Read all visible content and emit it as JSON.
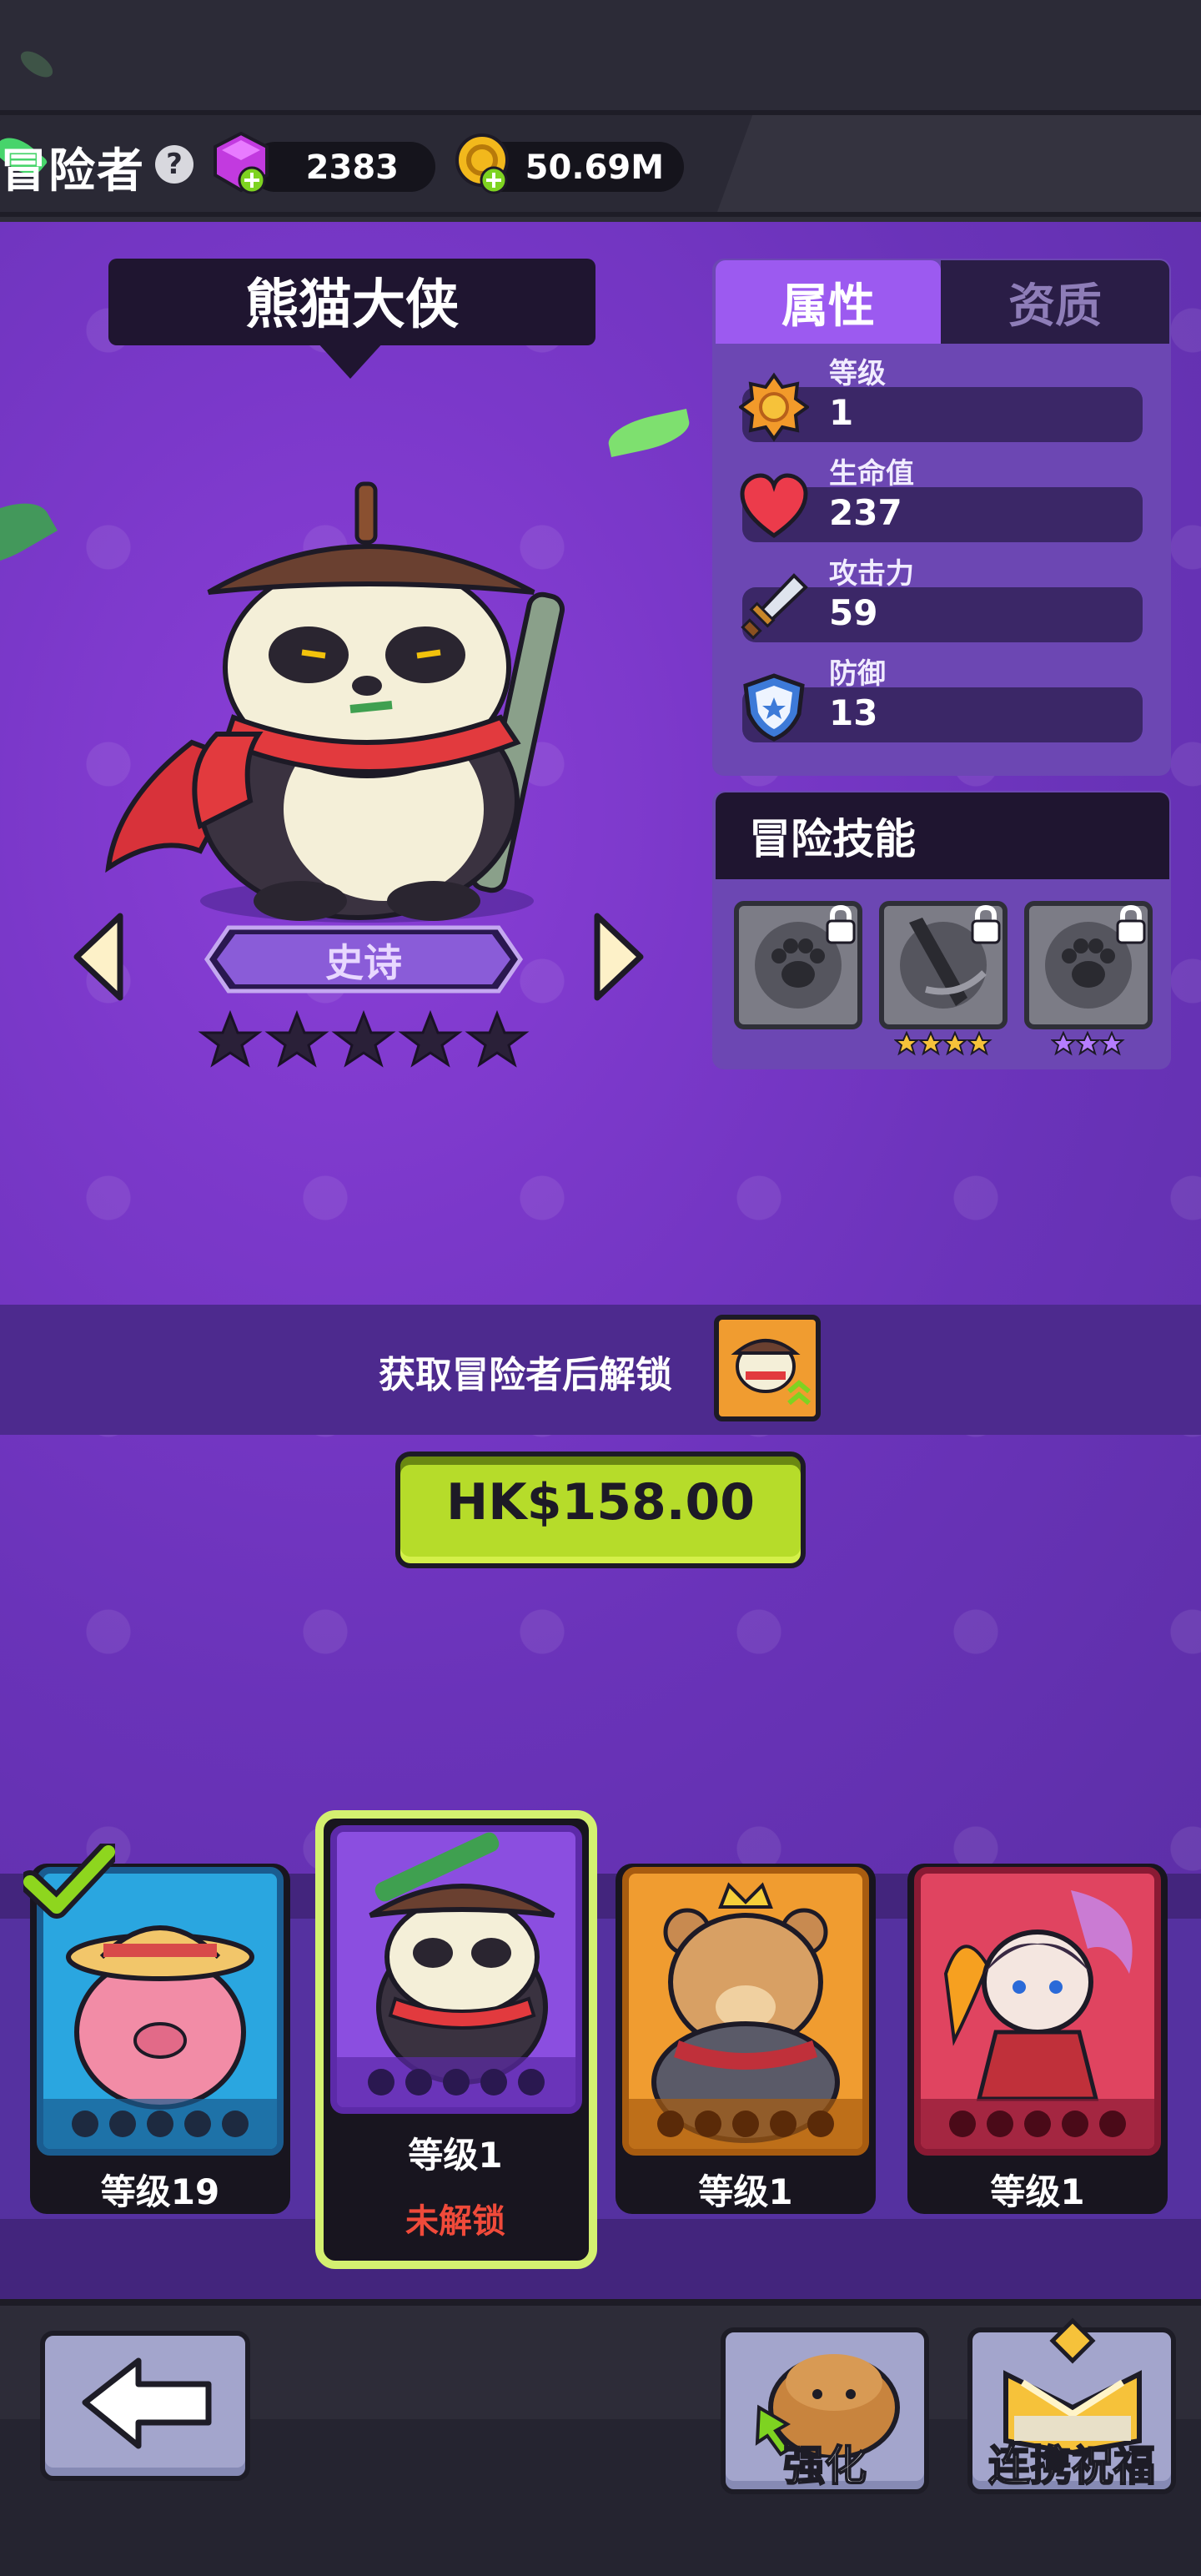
{
  "header": {
    "title": "冒险者",
    "help_icon": "question-icon",
    "gems": "2383",
    "gold": "50.69M"
  },
  "hero": {
    "name": "熊猫大侠",
    "rarity": "史诗",
    "stars": 5
  },
  "stats_panel": {
    "tabs": [
      "属性",
      "资质"
    ],
    "active_tab": "属性",
    "stats": [
      {
        "label": "等级",
        "value": "1",
        "icon": "level-badge-icon"
      },
      {
        "label": "生命值",
        "value": "237",
        "icon": "heart-icon"
      },
      {
        "label": "攻击力",
        "value": "59",
        "icon": "sword-icon"
      },
      {
        "label": "防御",
        "value": "13",
        "icon": "shield-icon"
      }
    ]
  },
  "skills": {
    "title": "冒险技能",
    "slots": [
      {
        "icon": "paw-skill-icon",
        "locked": true,
        "stars": 0
      },
      {
        "icon": "sword-slash-skill-icon",
        "locked": true,
        "stars": 4,
        "star_color": "#f6c23a"
      },
      {
        "icon": "paw-skill-icon",
        "locked": true,
        "stars": 3,
        "star_color": "#b57cff"
      }
    ]
  },
  "unlock": {
    "text": "获取冒险者后解锁",
    "buy_label": "HK$158.00"
  },
  "roster": [
    {
      "level": "等级19",
      "owned": true,
      "color": "#2aa6e0"
    },
    {
      "level": "等级1",
      "status": "未解锁",
      "selected": true,
      "color": "#8b4ee0"
    },
    {
      "level": "等级1",
      "color": "#f09c30"
    },
    {
      "level": "等级1",
      "color": "#e04460"
    }
  ],
  "bottom": {
    "enhance_label": "强化",
    "bless_label": "连携祝福"
  },
  "colors": {
    "accent_green": "#b6dc2a",
    "locked_red": "#f04a3a",
    "panel_purple": "#6c47b3"
  }
}
